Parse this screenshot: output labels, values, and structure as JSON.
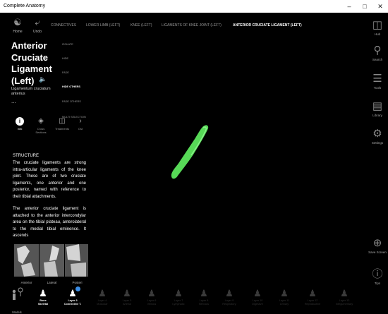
{
  "window": {
    "title": "Complete Anatomy",
    "controls": [
      "–",
      "□",
      "✕"
    ]
  },
  "toolbar": {
    "home": "Home",
    "undo": "Undo",
    "breadcrumbs": [
      "CONNECTIVES",
      "LOWER LIMB (LEFT)",
      "KNEE (LEFT)",
      "LIGAMENTS OF KNEE JOINT (LEFT)",
      "ANTERIOR CRUCIATE LIGAMENT (LEFT)"
    ]
  },
  "structure": {
    "title": "Anterior Cruciate Ligament (Left)",
    "latin": "Ligamentum cruciatum anterius",
    "more": "..."
  },
  "options": [
    "ISOLATE",
    "HIDE",
    "FADE",
    "HIDE OTHERS",
    "FADE OTHERS",
    "MULTI SELECTION"
  ],
  "tabs": [
    "Info",
    "Cross Sections",
    "Treatments",
    "Ost"
  ],
  "section_heading": "STRUCTURE",
  "description": [
    "The cruciate ligaments are strong intra-articular ligaments of the knee joint. These are of two cruciate ligaments, one anterior and one posterior, named with reference to their tibial attachments.",
    "The anterior cruciate ligament is attached to the anterior intercondylar area on the tibial plateau, anterolateral to the medial tibial eminence. It ascends"
  ],
  "thumbnails": [
    "Anterior",
    "Lateral",
    "Posteri"
  ],
  "sidebar": [
    "Hub",
    "Search",
    "Tools",
    "Library",
    "Settings",
    "Save Screen",
    "Tips"
  ],
  "layers": {
    "models": "Models",
    "items": [
      {
        "name": "Bone",
        "sub": "Skeletal",
        "on": true
      },
      {
        "name": "Layer 3",
        "sub": "Connective T.",
        "on": true
      },
      {
        "name": "Layer 4",
        "sub": "Muscular",
        "on": false
      },
      {
        "name": "Layer 5",
        "sub": "Arterial",
        "on": false
      },
      {
        "name": "Layer 6",
        "sub": "Venous",
        "on": false
      },
      {
        "name": "Layer 7",
        "sub": "Lymphatic",
        "on": false
      },
      {
        "name": "Layer 8",
        "sub": "Nervous",
        "on": false
      },
      {
        "name": "Layer 9",
        "sub": "Respiratory",
        "on": false
      },
      {
        "name": "Layer 10",
        "sub": "Digestive",
        "on": false
      },
      {
        "name": "Layer 11",
        "sub": "Urinary",
        "on": false
      },
      {
        "name": "Layer 12",
        "sub": "Reproductive",
        "on": false
      },
      {
        "name": "Layer 13",
        "sub": "Integumentary",
        "on": false
      }
    ]
  },
  "colors": {
    "ligament": "#57d957",
    "selected_layer": "#ffffff",
    "badge": "#3b8fe8"
  }
}
